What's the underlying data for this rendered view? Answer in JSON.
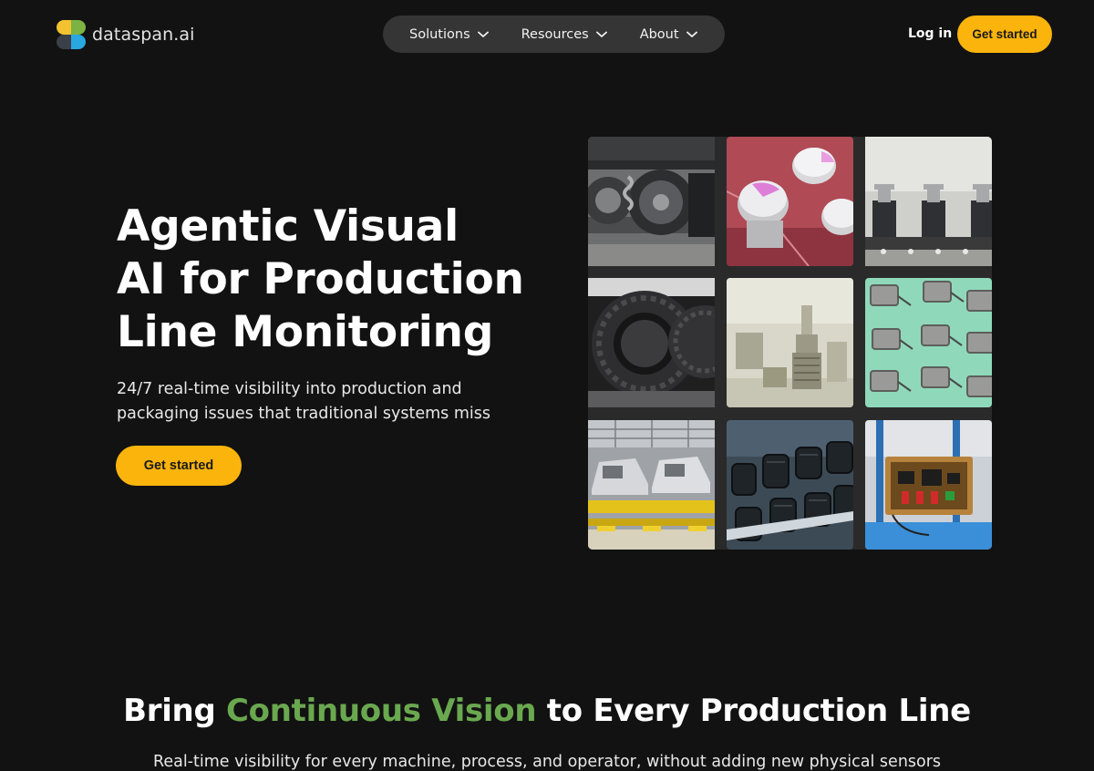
{
  "brand": {
    "name": "dataspan.ai",
    "colors": {
      "accent": "#fbb40c",
      "highlight": "#6aa84f",
      "background": "#121212",
      "nav_pill": "#353535"
    }
  },
  "nav": {
    "items": [
      {
        "label": "Solutions",
        "icon": "chevron-down-icon"
      },
      {
        "label": "Resources",
        "icon": "chevron-down-icon"
      },
      {
        "label": "About",
        "icon": "chevron-down-icon"
      }
    ],
    "login_label": "Log in",
    "cta_label": "Get started"
  },
  "hero": {
    "title_lines": [
      "Agentic Visual",
      "AI for Production",
      "Line Monitoring"
    ],
    "subtitle_lines": [
      "24/7 real-time visibility into production and",
      "packaging issues that traditional systems miss"
    ],
    "cta_label": "Get started"
  },
  "gallery": {
    "images": [
      "train-bogie-image",
      "capacitors-pcb-image",
      "toggle-switches-image",
      "tires-image",
      "metal-parts-image",
      "sensors-mint-image",
      "car-assembly-image",
      "black-gears-image",
      "robot-electronics-image"
    ]
  },
  "section2": {
    "title_before": "Bring ",
    "title_highlight": "Continuous Vision",
    "title_after": " to Every Production Line",
    "subtitle": "Real-time visibility for every machine, process, and operator, without adding new physical sensors"
  }
}
